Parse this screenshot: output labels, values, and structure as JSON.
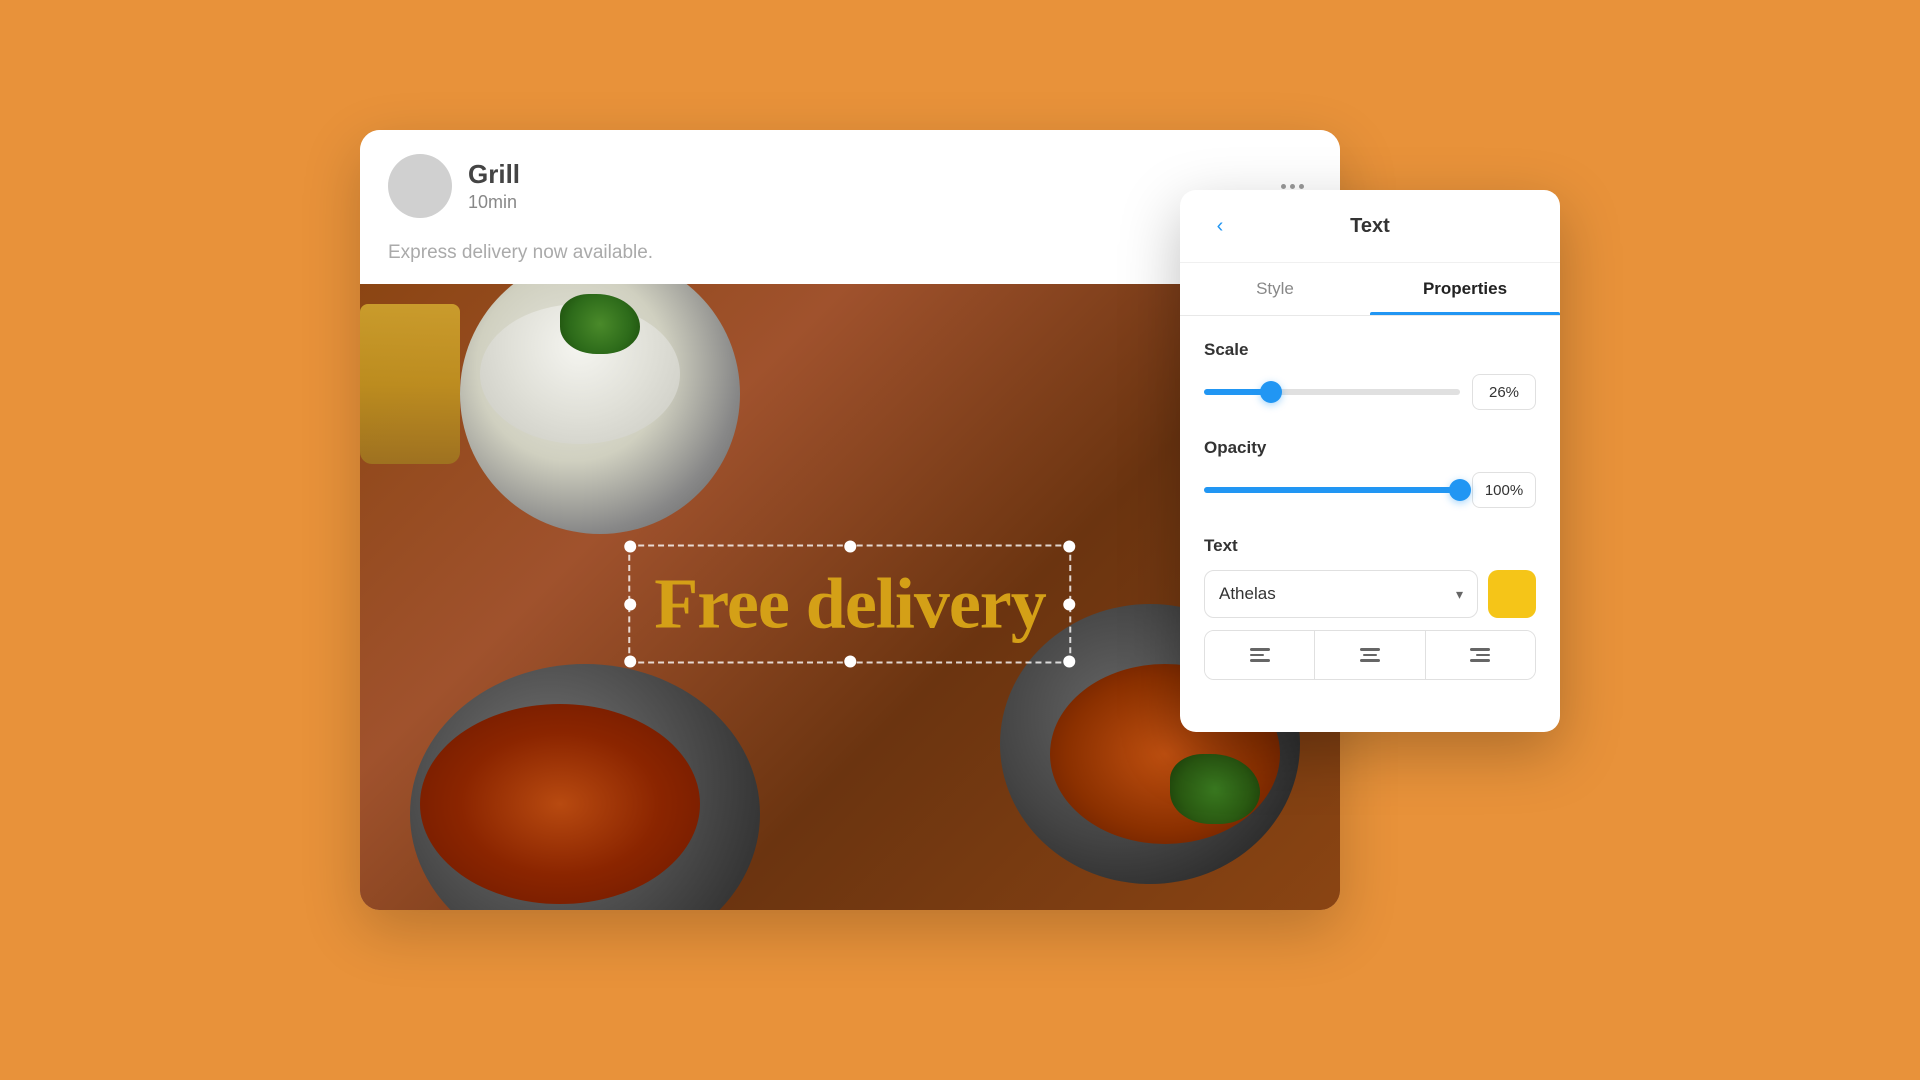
{
  "background": {
    "color": "#E8923A"
  },
  "main_card": {
    "header": {
      "title": "Grill",
      "subtitle": "10min",
      "description": "Express delivery now available.",
      "more_button_label": "..."
    },
    "overlay_text": "Free delivery"
  },
  "properties_panel": {
    "title": "Text",
    "back_label": "‹",
    "tabs": [
      {
        "label": "Style",
        "active": false
      },
      {
        "label": "Properties",
        "active": true
      }
    ],
    "scale": {
      "label": "Scale",
      "value": 26,
      "display": "26%",
      "fill_percent": 26
    },
    "opacity": {
      "label": "Opacity",
      "value": 100,
      "display": "100%",
      "fill_percent": 100
    },
    "text_section": {
      "label": "Text",
      "font": {
        "name": "Athelas",
        "dropdown_label": "Athelas"
      },
      "color": "#F5C518",
      "alignment": {
        "left_label": "align-left",
        "center_label": "align-center",
        "right_label": "align-right"
      }
    }
  }
}
